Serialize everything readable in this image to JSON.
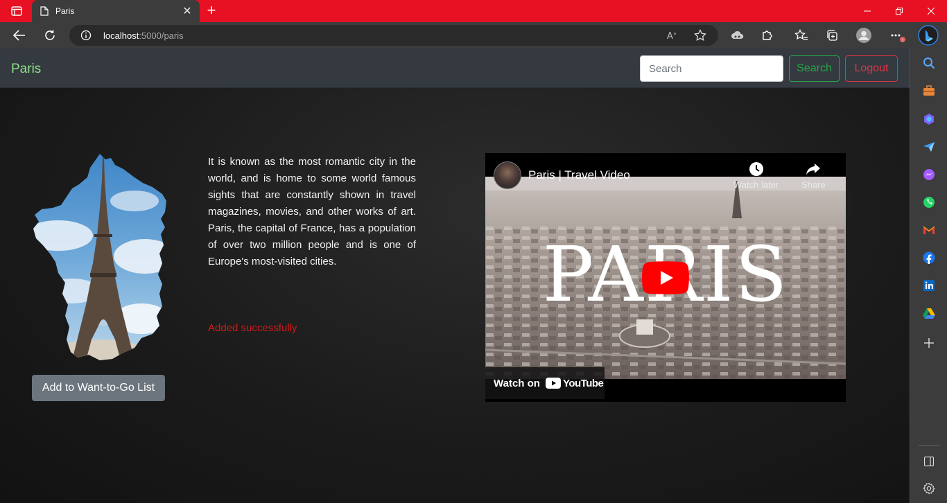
{
  "browser": {
    "tab_title": "Paris",
    "url_host": "localhost",
    "url_path": ":5000/paris",
    "tab_close": "✕",
    "new_tab": "+"
  },
  "site": {
    "brand": "Paris",
    "search_placeholder": "Search",
    "search_button": "Search",
    "logout_button": "Logout"
  },
  "content": {
    "description": "It is known as the most romantic city in the world, and is home to some world famous sights that are constantly shown in travel magazines, movies, and other works of art. Paris, the capital of France, has a population of over two million people and is one of Europe's most-visited cities.",
    "status_message": "Added successfully",
    "add_button": "Add to Want-to-Go List"
  },
  "video": {
    "title": "Paris | Travel Video",
    "watch_later": "Watch later",
    "share": "Share",
    "overlay_word": "PARIS",
    "watch_on": "Watch on",
    "platform": "YouTube"
  },
  "colors": {
    "titlebar": "#e81123",
    "brand": "#8fe08a",
    "success": "#28a745",
    "danger": "#dc3545",
    "status": "#d11a1a"
  },
  "icons": {
    "sidebar": [
      "search-icon",
      "briefcase-icon",
      "copilot-icon",
      "send-icon",
      "messenger-icon",
      "whatsapp-icon",
      "gmail-icon",
      "facebook-icon",
      "linkedin-icon",
      "drive-icon",
      "add-icon"
    ]
  }
}
